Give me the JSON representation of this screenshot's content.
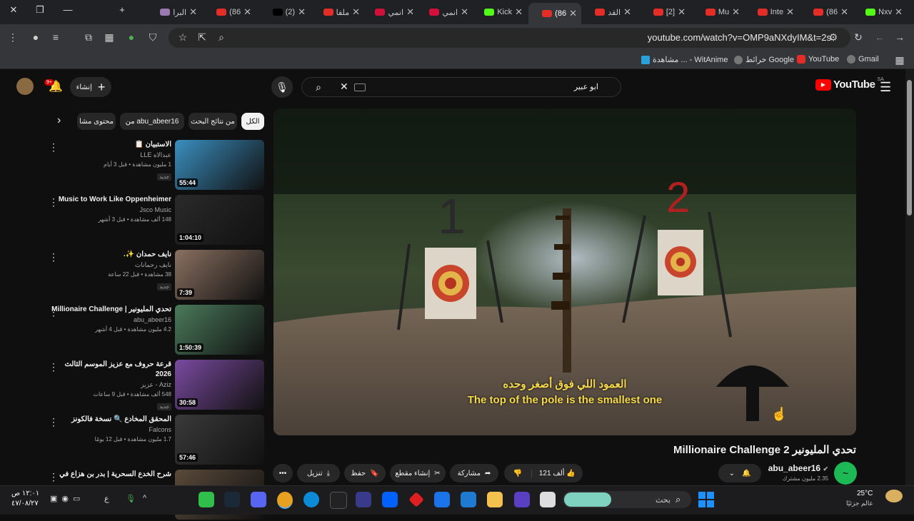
{
  "browser": {
    "tabs": [
      {
        "label": "Nxv",
        "icon": "kick-icon"
      },
      {
        "label": "86)",
        "icon": "youtube-icon"
      },
      {
        "label": "Inte",
        "icon": "youtube-icon"
      },
      {
        "label": "Mu",
        "icon": "youtube-icon"
      },
      {
        "label": "[2]",
        "icon": "youtube-icon"
      },
      {
        "label": "القد",
        "icon": "youtube-icon"
      },
      {
        "label": "86)",
        "icon": "youtube-icon",
        "active": true
      },
      {
        "label": "Kick",
        "icon": "kick-icon"
      },
      {
        "label": "انمي",
        "icon": "bookmark-icon"
      },
      {
        "label": "انمي",
        "icon": "bookmark-icon"
      },
      {
        "label": "ملفا",
        "icon": "youtube-icon"
      },
      {
        "label": "(2)",
        "icon": "x-icon"
      },
      {
        "label": "86)",
        "icon": "youtube-icon"
      },
      {
        "label": "البرا",
        "icon": "image-icon"
      }
    ],
    "url": "youtube.com/watch?v=OMP9aNXdyIM&t=2s",
    "bookmarks": [
      {
        "label": "Gmail"
      },
      {
        "label": "YouTube"
      },
      {
        "label": "خرائط Google"
      },
      {
        "label": "مشاهدة ... - WitAnime"
      }
    ]
  },
  "youtube": {
    "logo_text": "YouTube",
    "region": "SA",
    "search_value": "ابو عبير",
    "create_label": "إنشاء",
    "notif_count": "9+",
    "chips": [
      "الكل",
      "من نتائج البحث",
      "من abu_abeer16",
      "محتوى مشا"
    ],
    "recommendations": [
      {
        "title": "الاستبيان 📋",
        "channel": "عبدالاه LLE",
        "stats": "1 مليون مشاهدة • قبل 3 أيام",
        "badge": "جديد",
        "duration": "55:44",
        "color": "#3a8fc0"
      },
      {
        "title": "Music to Work Like Oppenheimer",
        "channel": "Jsco Music",
        "stats": "148 ألف مشاهدة • قبل 3 أشهر",
        "badge": "",
        "duration": "1:04:10",
        "color": "#2a2a2a"
      },
      {
        "title": "نايف حمدان ✨.",
        "channel": "نايف رحمانات",
        "stats": "38 مشاهدة • قبل 22 ساعة",
        "badge": "جديد",
        "duration": "7:39",
        "color": "#8a7060"
      },
      {
        "title": "تحدي المليونير | Millionaire Challenge",
        "channel": "abu_abeer16",
        "stats": "4.2 مليون مشاهدة • قبل 4 أشهر",
        "badge": "",
        "duration": "1:50:39",
        "color": "#4a7a5a"
      },
      {
        "title": "قرعة حروف مع عزيز الموسم الثالث 2026",
        "channel": "Aziz - عزيز",
        "stats": "548 ألف مشاهدة • قبل 9 ساعات",
        "badge": "جديد",
        "duration": "30:58",
        "color": "#7a4aa0"
      },
      {
        "title": "المحقق المخادع 🔍 نسخة فالكونز",
        "channel": "Falcons",
        "stats": "1.7 مليون مشاهدة • قبل 12 يومًا",
        "badge": "",
        "duration": "57:46",
        "color": "#3a3a3a"
      },
      {
        "title": "شرح الخدع السحرية | بدر بن هزاع في",
        "channel": "",
        "stats": "",
        "badge": "",
        "duration": "",
        "color": "#5a4a3a"
      }
    ],
    "video": {
      "subtitle_ar": "العمود اللي فوق أصغر وحده",
      "subtitle_en": "The top of the pole is the smallest one",
      "title": "تحدي المليونير Millionaire Challenge 2",
      "channel": "abu_abeer16",
      "subscribers": "2.35 مليون مشترك",
      "likes": "121 ألف",
      "share": "مشاركة",
      "clip": "إنشاء مقطع",
      "save": "حفظ",
      "download": "تنزيل",
      "scene_labels": [
        "1",
        "2"
      ]
    }
  },
  "taskbar": {
    "weather_temp": "25°C",
    "weather_text": "عالم جزئيًا",
    "search_label": "بحث",
    "time": "١٢:٠١ ص",
    "date": "٤٧/٠٨/٢٧"
  }
}
